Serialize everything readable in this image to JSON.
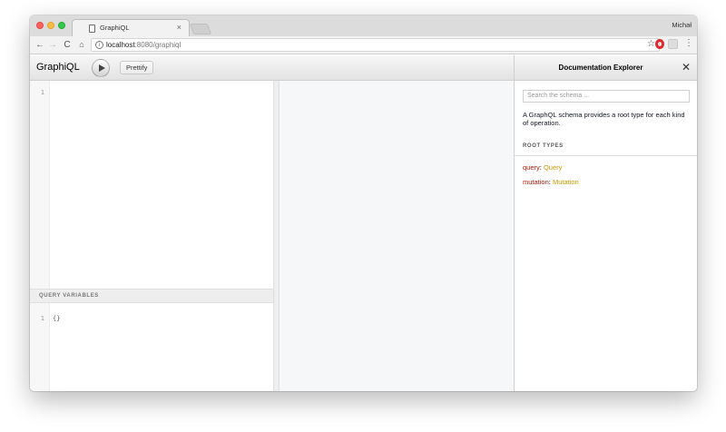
{
  "browser": {
    "tab_title": "GraphiQL",
    "tab_close": "×",
    "profile_name": "Michał",
    "url_host": "localhost",
    "url_rest": ":8080/graphiql",
    "nav_back": "←",
    "nav_forward": "→",
    "nav_reload": "C",
    "nav_home": "⌂",
    "bookmark_star": "☆",
    "menu_dots": "⋮"
  },
  "toolbar": {
    "logo": "GraphiQL",
    "prettify_label": "Prettify"
  },
  "query_editor": {
    "line_numbers": [
      "1"
    ],
    "content": ""
  },
  "variables": {
    "header": "QUERY VARIABLES",
    "line_numbers": [
      "1"
    ],
    "content": "{}"
  },
  "docs": {
    "title": "Documentation Explorer",
    "close": "✕",
    "search_placeholder": "Search the schema ...",
    "description": "A GraphQL schema provides a root type for each kind of operation.",
    "section_title": "ROOT TYPES",
    "root_types": [
      {
        "field": "query",
        "type": "Query"
      },
      {
        "field": "mutation",
        "type": "Mutation"
      }
    ]
  },
  "colors": {
    "field": "#b11a04",
    "type": "#ca9800"
  }
}
